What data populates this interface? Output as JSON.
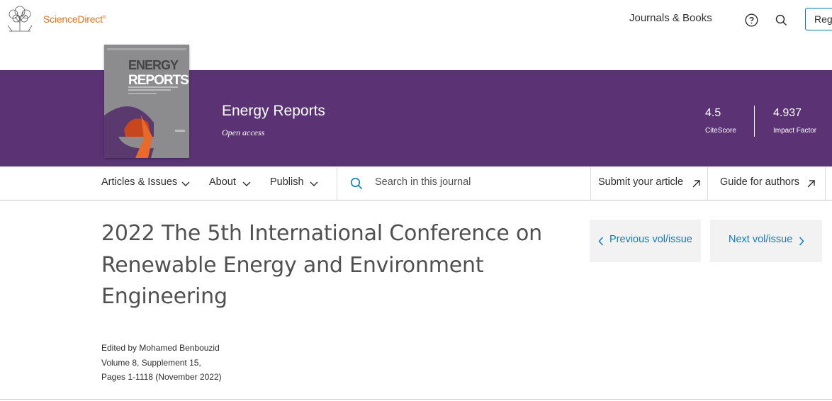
{
  "header": {
    "brand": "ScienceDirect",
    "brand_mark": "®",
    "journals_books": "Journals & Books",
    "register": "Reg"
  },
  "journal": {
    "title": "Energy Reports",
    "access": "Open access",
    "cover_title_line1": "ENERGY",
    "cover_title_line2": "REPORTS",
    "metrics": [
      {
        "value": "4.5",
        "label": "CiteScore"
      },
      {
        "value": "4.937",
        "label": "Impact Factor"
      }
    ]
  },
  "journal_nav": {
    "articles_issues": "Articles & Issues",
    "about": "About",
    "publish": "Publish",
    "search_placeholder": "Search in this journal",
    "submit": "Submit your article",
    "guide": "Guide for authors"
  },
  "issue": {
    "title": "2022 The 5th International Conference on Renewable Energy and Environment Engineering",
    "editor": "Edited by Mohamed Benbouzid",
    "volume": "Volume 8, Supplement 15,",
    "pages": "Pages 1-1118 (November 2022)",
    "prev": "Previous vol/issue",
    "next": "Next vol/issue"
  },
  "colors": {
    "banner": "#5b3375",
    "brand": "#e9711c",
    "link": "#0c7dbb"
  },
  "icons": [
    "elsevier-tree-icon",
    "help-icon",
    "search-icon",
    "chevron-down-icon",
    "external-arrow-icon",
    "chevron-left-icon",
    "chevron-right-icon"
  ]
}
